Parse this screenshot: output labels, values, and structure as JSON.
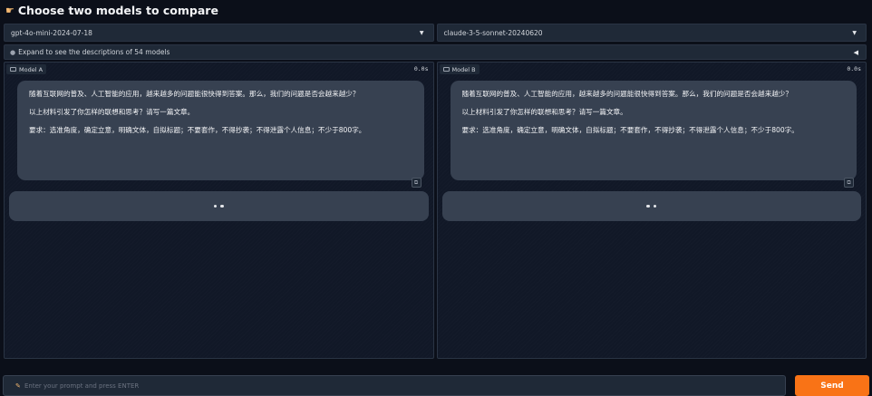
{
  "header": {
    "title": "Choose two models to compare",
    "icon": "pointing-hand-icon"
  },
  "model_selectors": [
    {
      "value": "gpt-4o-mini-2024-07-18"
    },
    {
      "value": "claude-3-5-sonnet-20240620"
    }
  ],
  "accordion": {
    "label": "Expand to see the descriptions of 54 models"
  },
  "panels": [
    {
      "label": "Model A",
      "timer": "0.0s",
      "user_message": [
        "随着互联网的普及、人工智能的应用，越来越多的问题能很快得到答案。那么，我们的问题是否会越来越少？",
        "以上材料引发了你怎样的联想和思考？请写一篇文章。",
        "要求：选准角度，确定立意，明确文体，自拟标题；不要套作，不得抄袭；不得泄露个人信息；不少于800字。"
      ]
    },
    {
      "label": "Model B",
      "timer": "0.0s",
      "user_message": [
        "随着互联网的普及、人工智能的应用，越来越多的问题能很快得到答案。那么，我们的问题是否会越来越少？",
        "以上材料引发了你怎样的联想和思考？请写一篇文章。",
        "要求：选准角度，确定立意，明确文体，自拟标题；不要套作，不得抄袭；不得泄露个人信息；不少于800字。"
      ]
    }
  ],
  "input": {
    "placeholder": "Enter your prompt and press ENTER",
    "value": ""
  },
  "send_button": {
    "label": "Send"
  },
  "colors": {
    "accent": "#f97316",
    "background": "#0b0f19",
    "bubble": "#374151"
  }
}
